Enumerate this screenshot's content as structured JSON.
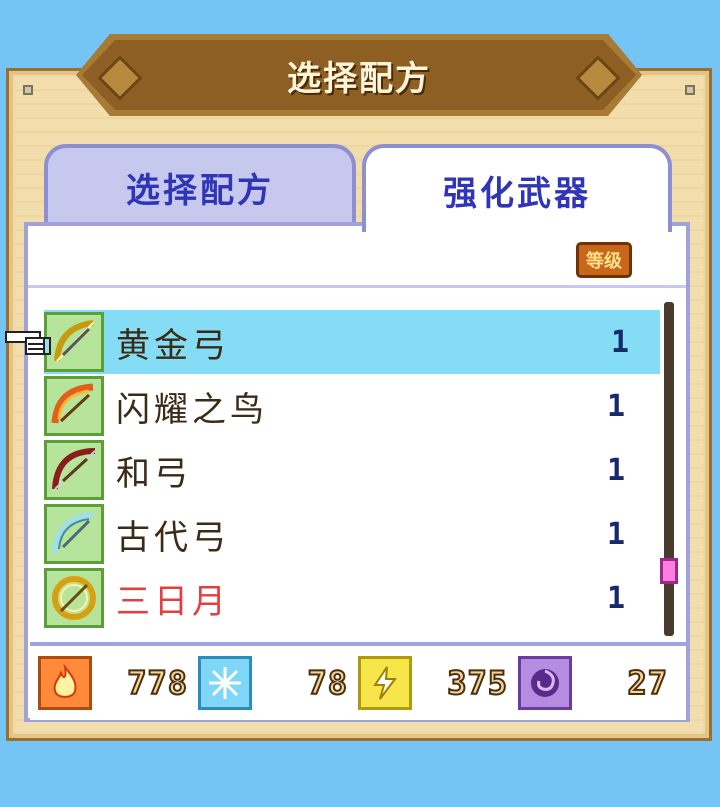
{
  "title": "选择配方",
  "tabs": [
    {
      "label": "选择配方",
      "active": false
    },
    {
      "label": "强化武器",
      "active": true
    }
  ],
  "header": {
    "level_badge": "等级"
  },
  "weapons": [
    {
      "name": "黄金弓",
      "level": "1",
      "icon": "golden-bow-icon",
      "selected": true,
      "color": "#3a2a16"
    },
    {
      "name": "闪耀之鸟",
      "level": "1",
      "icon": "shining-bird-bow-icon",
      "selected": false,
      "color": "#3a2a16"
    },
    {
      "name": "和弓",
      "level": "1",
      "icon": "japanese-bow-icon",
      "selected": false,
      "color": "#3a2a16"
    },
    {
      "name": "古代弓",
      "level": "1",
      "icon": "ancient-bow-icon",
      "selected": false,
      "color": "#3a2a16"
    },
    {
      "name": "三日月",
      "level": "1",
      "icon": "crescent-moon-bow-icon",
      "selected": false,
      "color": "#e04040"
    }
  ],
  "scroll": {
    "position_fraction": 0.85
  },
  "resources": [
    {
      "name": "fire",
      "value": "778",
      "icon": "fire-icon",
      "bg": "#ff8a3a",
      "border": "#b04b10"
    },
    {
      "name": "ice",
      "value": "78",
      "icon": "ice-snowflake-icon",
      "bg": "#7fd6f7",
      "border": "#2b8cc0"
    },
    {
      "name": "thunder",
      "value": "375",
      "icon": "lightning-icon",
      "bg": "#f6e64a",
      "border": "#b09a10"
    },
    {
      "name": "dark",
      "value": "27",
      "icon": "dark-vortex-icon",
      "bg": "#b58ce0",
      "border": "#6b3ca0"
    }
  ]
}
